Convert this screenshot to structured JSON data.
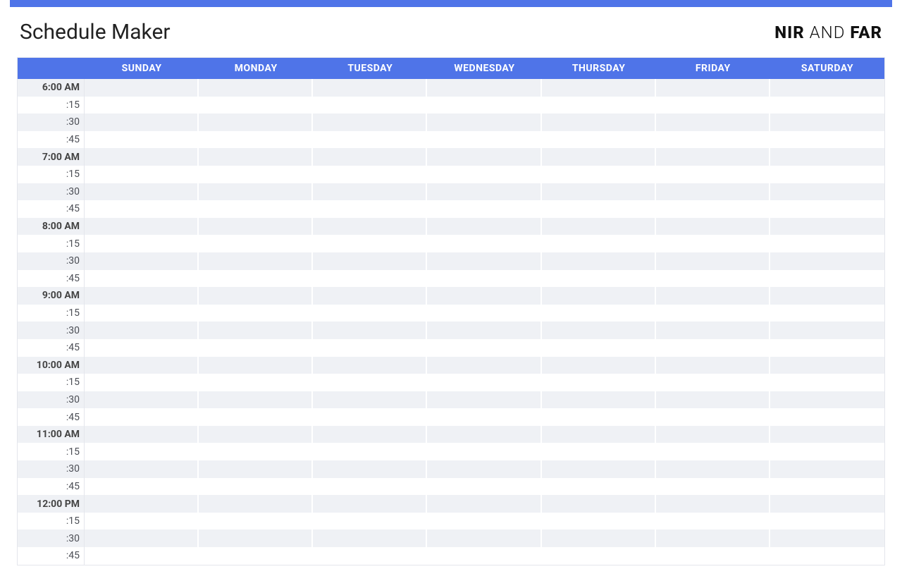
{
  "header": {
    "title": "Schedule Maker",
    "logo": {
      "part1": "NIR",
      "part2": " AND ",
      "part3": "FAR"
    }
  },
  "days": [
    "SUNDAY",
    "MONDAY",
    "TUESDAY",
    "WEDNESDAY",
    "THURSDAY",
    "FRIDAY",
    "SATURDAY"
  ],
  "timeRows": [
    {
      "label": "6:00 AM",
      "hour": true
    },
    {
      "label": ":15",
      "hour": false
    },
    {
      "label": ":30",
      "hour": false
    },
    {
      "label": ":45",
      "hour": false
    },
    {
      "label": "7:00 AM",
      "hour": true
    },
    {
      "label": ":15",
      "hour": false
    },
    {
      "label": ":30",
      "hour": false
    },
    {
      "label": ":45",
      "hour": false
    },
    {
      "label": "8:00 AM",
      "hour": true
    },
    {
      "label": ":15",
      "hour": false
    },
    {
      "label": ":30",
      "hour": false
    },
    {
      "label": ":45",
      "hour": false
    },
    {
      "label": "9:00 AM",
      "hour": true
    },
    {
      "label": ":15",
      "hour": false
    },
    {
      "label": ":30",
      "hour": false
    },
    {
      "label": ":45",
      "hour": false
    },
    {
      "label": "10:00 AM",
      "hour": true
    },
    {
      "label": ":15",
      "hour": false
    },
    {
      "label": ":30",
      "hour": false
    },
    {
      "label": ":45",
      "hour": false
    },
    {
      "label": "11:00 AM",
      "hour": true
    },
    {
      "label": ":15",
      "hour": false
    },
    {
      "label": ":30",
      "hour": false
    },
    {
      "label": ":45",
      "hour": false
    },
    {
      "label": "12:00 PM",
      "hour": true
    },
    {
      "label": ":15",
      "hour": false
    },
    {
      "label": ":30",
      "hour": false
    },
    {
      "label": ":45",
      "hour": false
    }
  ],
  "colors": {
    "accent": "#4f74e8",
    "stripe": "#eff1f5"
  }
}
